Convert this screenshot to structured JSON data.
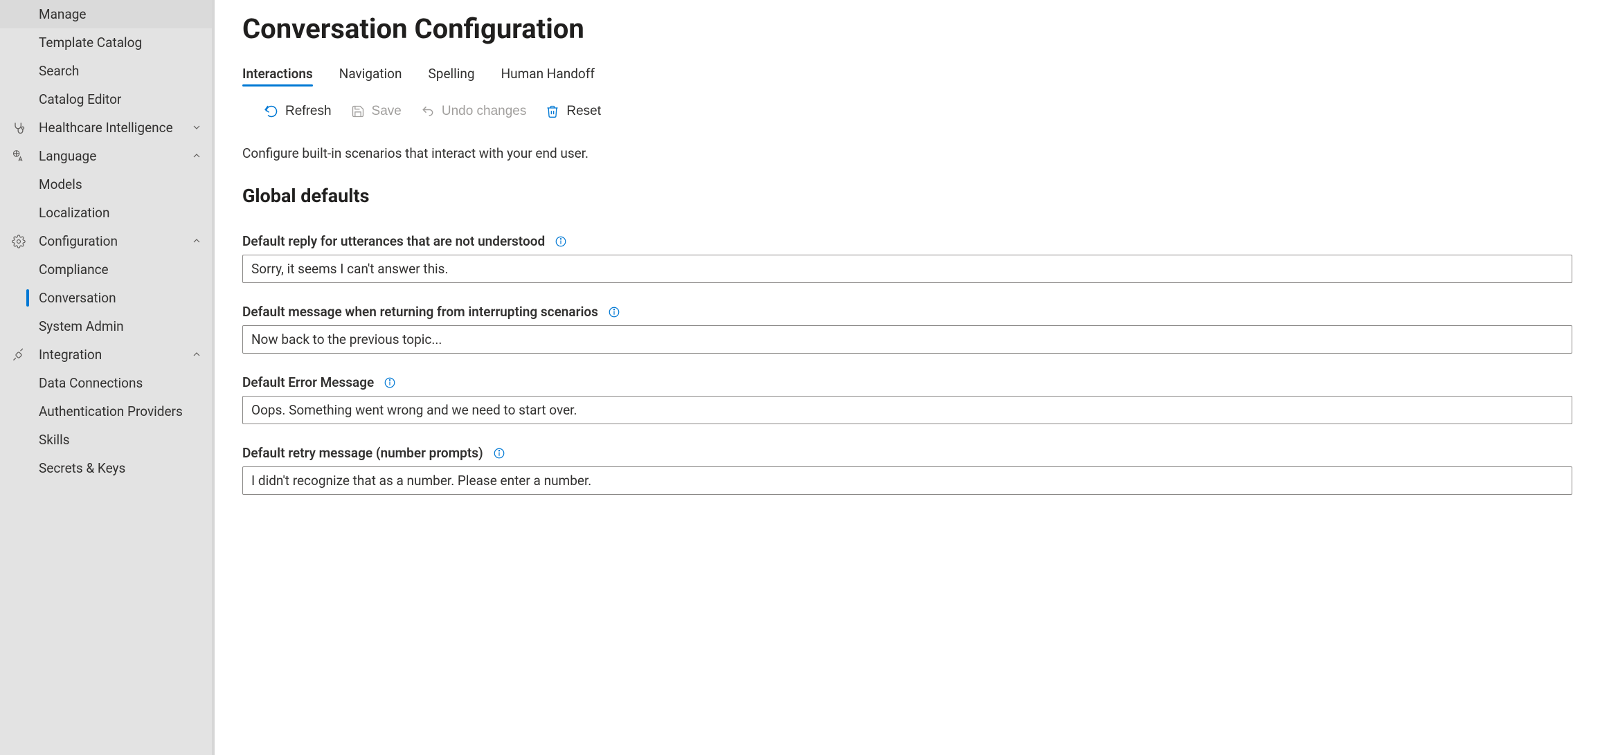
{
  "sidebar": {
    "top_items": [
      {
        "label": "Manage"
      },
      {
        "label": "Template Catalog"
      },
      {
        "label": "Search"
      },
      {
        "label": "Catalog Editor"
      }
    ],
    "groups": [
      {
        "icon": "stethoscope-icon",
        "label": "Healthcare Intelligence",
        "expanded": false,
        "items": []
      },
      {
        "icon": "language-icon",
        "label": "Language",
        "expanded": true,
        "items": [
          {
            "label": "Models",
            "active": false
          },
          {
            "label": "Localization",
            "active": false
          }
        ]
      },
      {
        "icon": "gear-icon",
        "label": "Configuration",
        "expanded": true,
        "items": [
          {
            "label": "Compliance",
            "active": false
          },
          {
            "label": "Conversation",
            "active": true
          },
          {
            "label": "System Admin",
            "active": false
          }
        ]
      },
      {
        "icon": "plug-icon",
        "label": "Integration",
        "expanded": true,
        "items": [
          {
            "label": "Data Connections",
            "active": false
          },
          {
            "label": "Authentication Providers",
            "active": false
          },
          {
            "label": "Skills",
            "active": false
          },
          {
            "label": "Secrets & Keys",
            "active": false
          }
        ]
      }
    ]
  },
  "page": {
    "title": "Conversation Configuration",
    "intro": "Configure built-in scenarios that interact with your end user.",
    "section_heading": "Global defaults"
  },
  "tabs": [
    {
      "label": "Interactions",
      "active": true
    },
    {
      "label": "Navigation",
      "active": false
    },
    {
      "label": "Spelling",
      "active": false
    },
    {
      "label": "Human Handoff",
      "active": false
    }
  ],
  "toolbar": {
    "refresh": "Refresh",
    "save": "Save",
    "undo": "Undo changes",
    "reset": "Reset"
  },
  "fields": [
    {
      "label": "Default reply for utterances that are not understood",
      "value": "Sorry, it seems I can't answer this."
    },
    {
      "label": "Default message when returning from interrupting scenarios",
      "value": "Now back to the previous topic..."
    },
    {
      "label": "Default Error Message",
      "value": "Oops. Something went wrong and we need to start over."
    },
    {
      "label": "Default retry message (number prompts)",
      "value": "I didn't recognize that as a number. Please enter a number."
    }
  ]
}
